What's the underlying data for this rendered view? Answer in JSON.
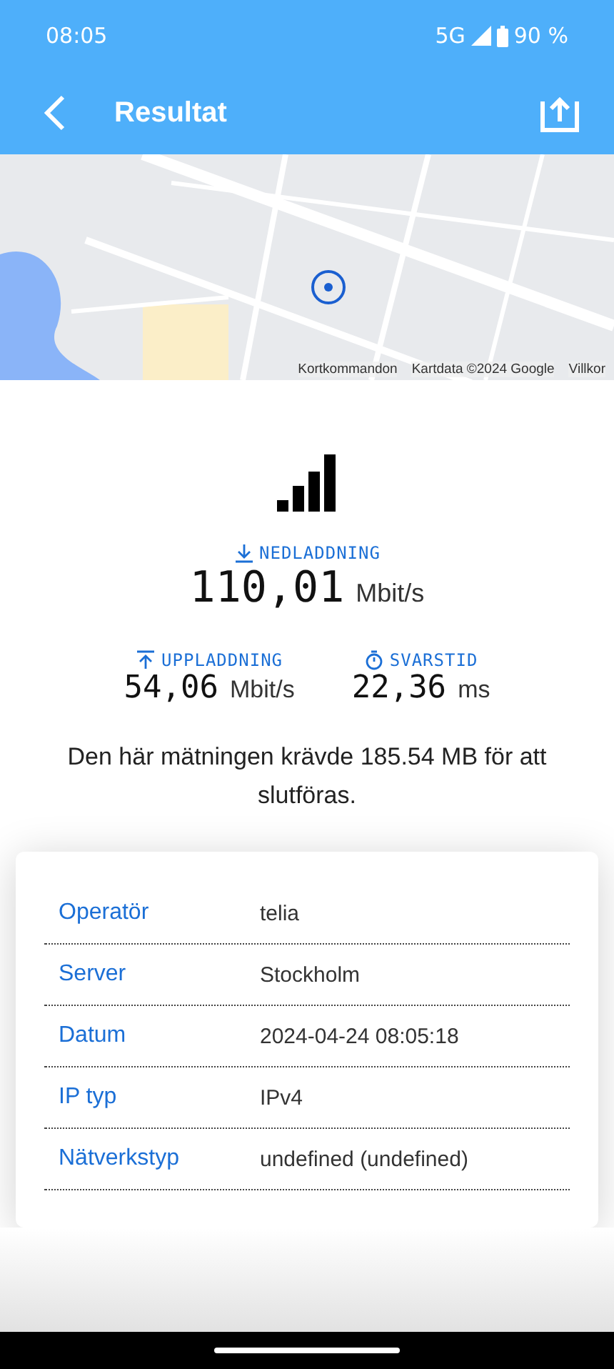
{
  "status_bar": {
    "time": "08:05",
    "network": "5G",
    "battery": "90 %"
  },
  "app_bar": {
    "title": "Resultat"
  },
  "map": {
    "kind": "picture",
    "attribution": [
      "Kortkommandon",
      "Kartdata ©2024 Google",
      "Villkor"
    ]
  },
  "main_metric": {
    "kind": "download",
    "label": "NEDLADDNING",
    "value": "110,01",
    "unit": "Mbit/s"
  },
  "metrics": [
    {
      "kind": "upload",
      "label": "UPPLADDNING",
      "value": "54,06",
      "unit": "Mbit/s"
    },
    {
      "kind": "latency",
      "label": "SVARSTID",
      "value": "22,36",
      "unit": "ms"
    }
  ],
  "note": "Den här mätningen krävde 185.54 MB för att slutföras.",
  "details": [
    {
      "label": "Operatör",
      "value": "telia"
    },
    {
      "label": "Server",
      "value": "Stockholm"
    },
    {
      "label": "Datum",
      "value": "2024-04-24 08:05:18"
    },
    {
      "label": "IP typ",
      "value": "IPv4"
    },
    {
      "label": "Nätverkstyp",
      "value": "undefined (undefined)"
    }
  ]
}
